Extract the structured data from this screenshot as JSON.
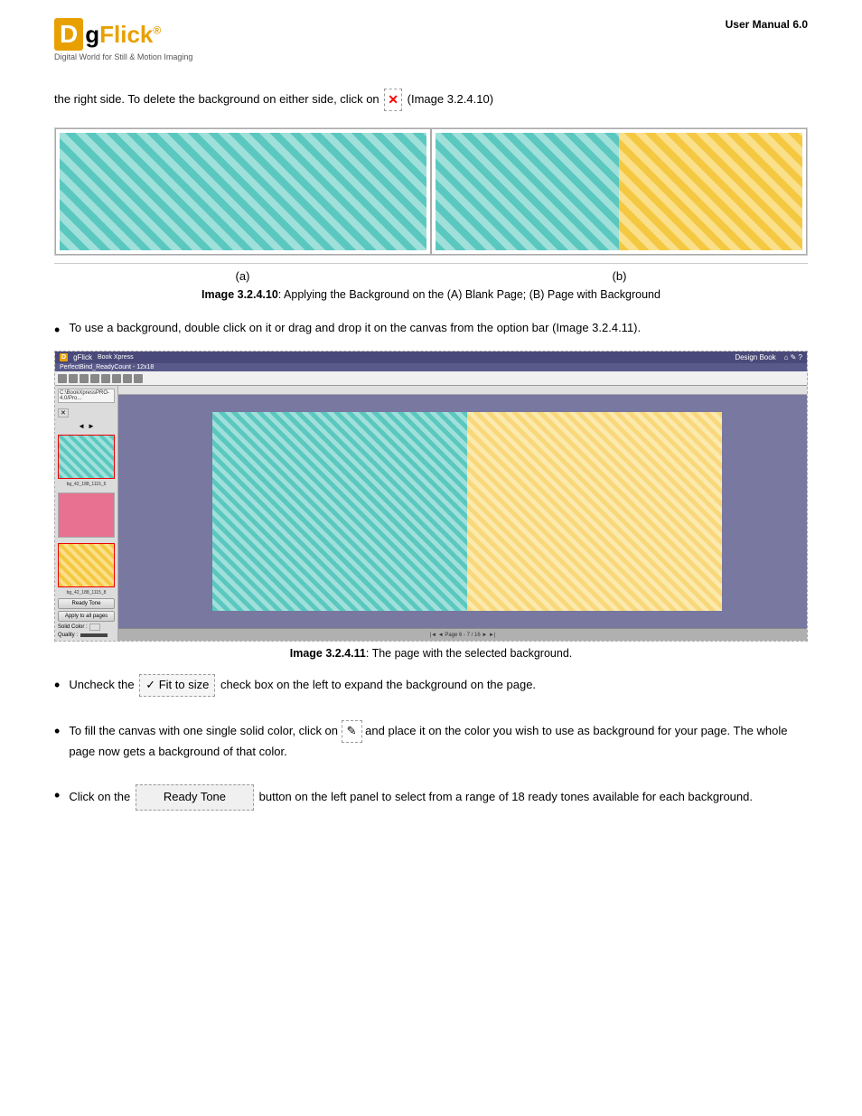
{
  "header": {
    "logo": {
      "letter": "D",
      "brand": "gFlick",
      "registered": "®",
      "tagline": "Digital World for Still & Motion Imaging"
    },
    "manual_version": "User Manual 6.0"
  },
  "intro": {
    "text_before_icon": "the right side. To delete the background on either side, click on",
    "text_after_icon": "(Image 3.2.4.10)"
  },
  "figure_ab": {
    "label_a": "(a)",
    "label_b": "(b)",
    "caption": "Image 3.2.4.10: Applying the Background on the (A) Blank Page; (B) Page with Background"
  },
  "screenshot": {
    "app_title": "Book Xpress",
    "design_title": "Design Book",
    "subtitle": "PerfectBind_ReadyCount - 12x18",
    "path": "C:\\BookXpressPRO-4.0/Pro...",
    "ready_tone_btn": "Ready Tone",
    "apply_all_btn": "Apply to all pages",
    "solid_color_label": "Solid Color :",
    "quality_label": "Quality :",
    "page_info": "Page 6 - 7 / 16",
    "caption": "Image 3.2.4.11: The page with the selected background."
  },
  "bullets": [
    {
      "id": "bullet1",
      "text_before_btn": "Uncheck the",
      "btn_label": "✓ Fit to size",
      "text_after_btn": "check box on the left to expand the background on the page."
    },
    {
      "id": "bullet2",
      "text_before_icon": "To fill the canvas with one single solid color, click on",
      "text_after_icon": "and place it on the color you wish to use as background for your page. The whole page now gets a background of that color."
    },
    {
      "id": "bullet3",
      "text_before_btn": "Click on the",
      "btn_label": "Ready Tone",
      "text_after_btn": "button on the left panel to select from a range of 18 ready tones available for each background."
    }
  ]
}
